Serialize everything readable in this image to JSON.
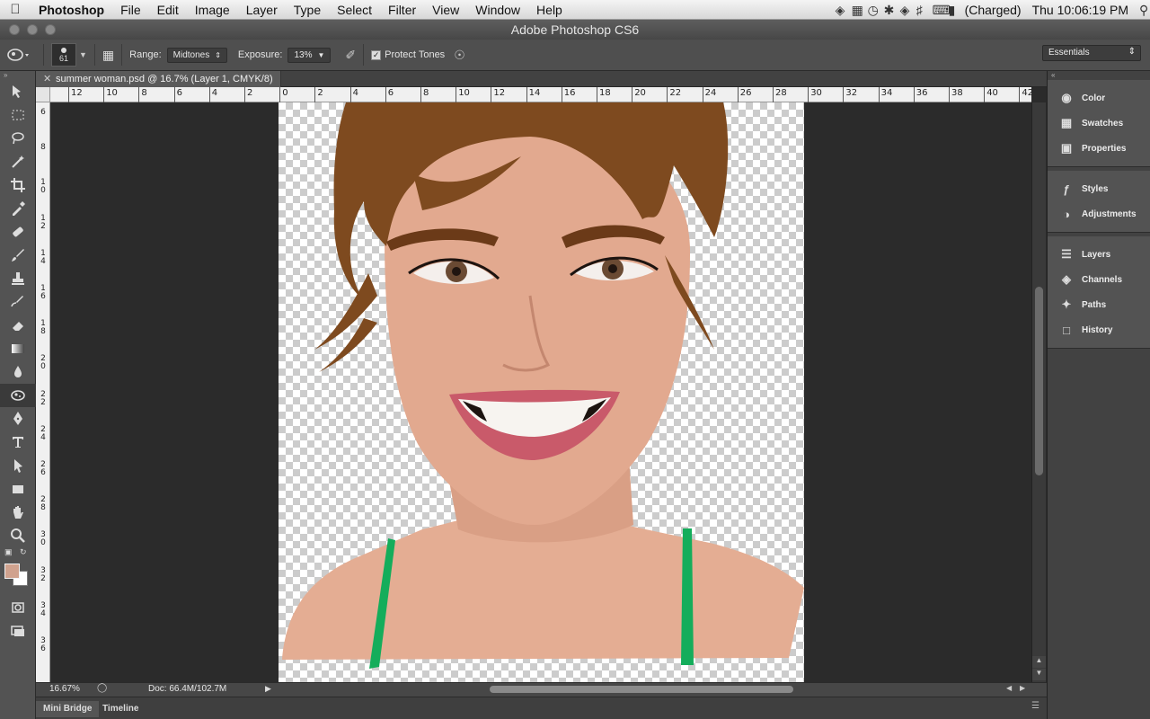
{
  "menubar": {
    "app_name": "Photoshop",
    "items": [
      "File",
      "Edit",
      "Image",
      "Layer",
      "Type",
      "Select",
      "Filter",
      "View",
      "Window",
      "Help"
    ],
    "battery_status": "(Charged)",
    "clock": "Thu 10:06:19 PM"
  },
  "window": {
    "title": "Adobe Photoshop CS6"
  },
  "options": {
    "brush_size": "61",
    "range_label": "Range:",
    "range_value": "Midtones",
    "exposure_label": "Exposure:",
    "exposure_value": "13%",
    "protect_tones_label": "Protect Tones",
    "protect_tones_checked": true,
    "workspace": "Essentials"
  },
  "document": {
    "tab_title": "summer woman.psd @ 16.7% (Layer 1, CMYK/8)",
    "zoom": "16.67%",
    "doc_size": "Doc: 66.4M/102.7M"
  },
  "ruler_h": [
    "12",
    "10",
    "8",
    "6",
    "4",
    "2",
    "0",
    "2",
    "4",
    "6",
    "8",
    "10",
    "12",
    "14",
    "16",
    "18",
    "20",
    "22",
    "24",
    "26",
    "28",
    "30",
    "32",
    "34",
    "36",
    "38",
    "40",
    "42"
  ],
  "ruler_v": [
    "6",
    "8",
    "10",
    "12",
    "14",
    "16",
    "18",
    "20",
    "22",
    "24",
    "26",
    "28",
    "30",
    "32",
    "34",
    "36"
  ],
  "panels": {
    "group1": [
      "Color",
      "Swatches",
      "Properties"
    ],
    "group2": [
      "Styles",
      "Adjustments"
    ],
    "group3": [
      "Layers",
      "Channels",
      "Paths",
      "History"
    ]
  },
  "bottom_tabs": [
    "Mini Bridge",
    "Timeline"
  ],
  "colors": {
    "foreground": "#d0a28e",
    "background": "#ffffff",
    "skin": "#e2a98f",
    "hair": "#7e4a1f",
    "strap": "#14ad5b",
    "lips": "#c95a6a"
  }
}
